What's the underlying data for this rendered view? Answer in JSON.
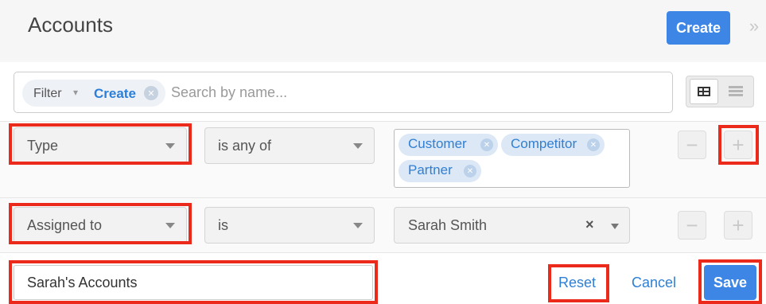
{
  "header": {
    "title": "Accounts",
    "create_label": "Create",
    "collapse_icon": "double-chevron-right-icon"
  },
  "search": {
    "filter_label": "Filter",
    "filter_caret": "▾",
    "active_filter": "Create",
    "placeholder": "Search by name..."
  },
  "view_toggle": {
    "active": "grid-icon",
    "inactive": "list-icon"
  },
  "rows": [
    {
      "field": "Type",
      "operator": "is any of",
      "values": [
        "Customer",
        "Competitor",
        "Partner"
      ]
    },
    {
      "field": "Assigned to",
      "operator": "is",
      "value": "Sarah Smith",
      "clear_icon": "×"
    }
  ],
  "row_buttons": {
    "remove": "−",
    "add": "+"
  },
  "footer": {
    "filter_name": "Sarah's Accounts",
    "reset_label": "Reset",
    "cancel_label": "Cancel",
    "save_label": "Save"
  },
  "colors": {
    "accent": "#3d86e6",
    "highlight": "#ec2a1c",
    "tag_text": "#2f7fd4"
  }
}
